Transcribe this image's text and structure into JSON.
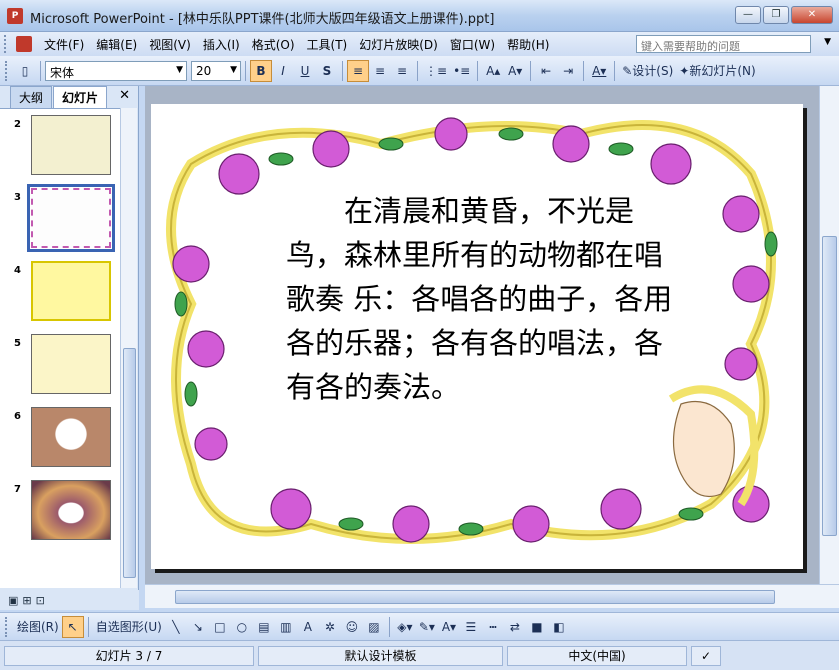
{
  "window": {
    "app_icon": "powerpoint-icon",
    "title": "Microsoft PowerPoint - [林中乐队PPT课件(北师大版四年级语文上册课件).ppt]",
    "controls": {
      "minimize": "—",
      "restore": "❐",
      "close": "✕"
    }
  },
  "menu": {
    "items": [
      "文件(F)",
      "编辑(E)",
      "视图(V)",
      "插入(I)",
      "格式(O)",
      "工具(T)",
      "幻灯片放映(D)",
      "窗口(W)",
      "帮助(H)"
    ],
    "help_placeholder": "键入需要帮助的问题"
  },
  "toolbar": {
    "font": "宋体",
    "size": "20",
    "bold": "B",
    "italic": "I",
    "underline": "U",
    "shadow": "S",
    "design_label": "设计(S)",
    "new_slide_label": "新幻灯片(N)",
    "accent_color": "#ffd08a"
  },
  "left_pane": {
    "tabs": [
      "大纲",
      "幻灯片"
    ],
    "close": "✕",
    "slides": [
      {
        "num": "2",
        "bg": "#f3f0d0"
      },
      {
        "num": "3",
        "bg": "#fdfdfd",
        "selected": true
      },
      {
        "num": "4",
        "bg": "#fff8a0"
      },
      {
        "num": "5",
        "bg": "#fbf5c8"
      },
      {
        "num": "6",
        "bg": "#b9876a"
      },
      {
        "num": "7",
        "bg": "#9b5a6b"
      }
    ]
  },
  "slide": {
    "text": "　　在清晨和黄昏，不光是鸟，森林里所有的动物都在唱歌奏 乐：各唱各的曲子，各用各的乐器；各有各的唱法，各有各的奏法。"
  },
  "drawbar": {
    "draw": "绘图(R)",
    "autoshapes": "自选图形(U)"
  },
  "status": {
    "slide": "幻灯片 3 / 7",
    "template": "默认设计模板",
    "language": "中文(中国)"
  }
}
